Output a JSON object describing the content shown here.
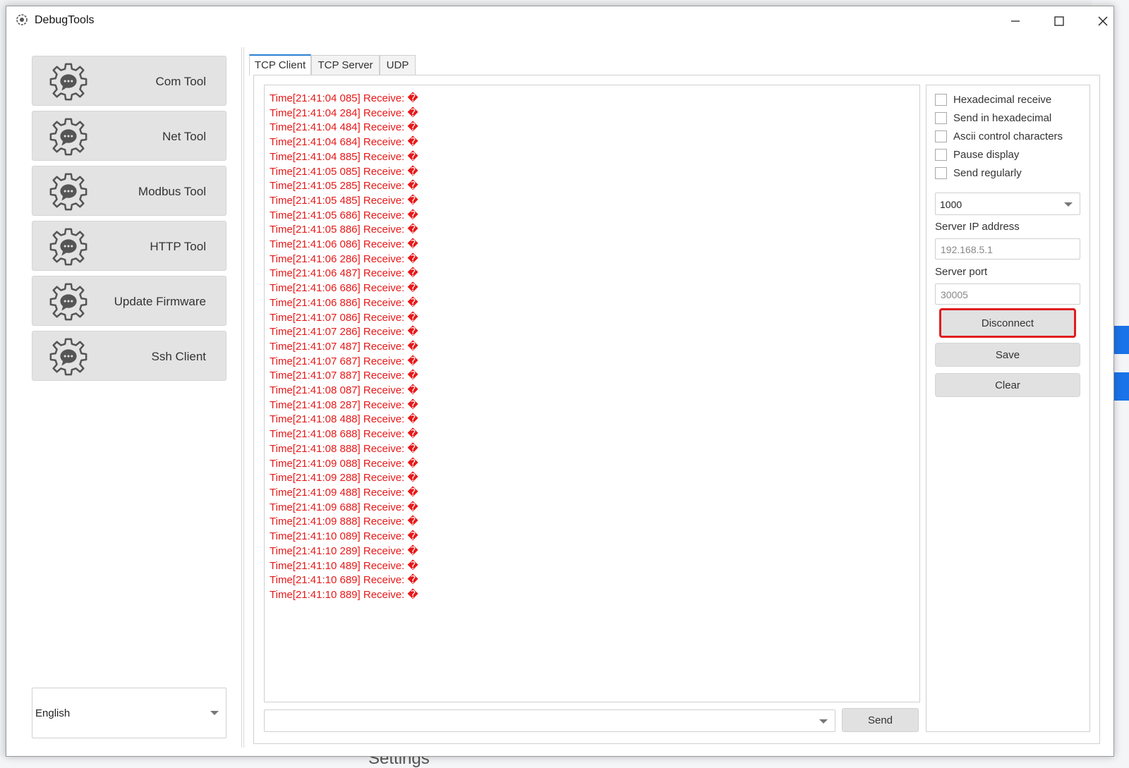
{
  "window": {
    "title": "DebugTools"
  },
  "sidebar": {
    "items": [
      {
        "label": "Com Tool"
      },
      {
        "label": "Net Tool"
      },
      {
        "label": "Modbus Tool"
      },
      {
        "label": "HTTP Tool"
      },
      {
        "label": "Update Firmware"
      },
      {
        "label": "Ssh Client"
      }
    ],
    "language": "English"
  },
  "tabs": [
    {
      "label": "TCP Client",
      "active": true
    },
    {
      "label": "TCP Server",
      "active": false
    },
    {
      "label": "UDP",
      "active": false
    }
  ],
  "log": {
    "lines": [
      "Time[21:41:04 085] Receive: �",
      "Time[21:41:04 284] Receive: �",
      "Time[21:41:04 484] Receive: �",
      "Time[21:41:04 684] Receive: �",
      "Time[21:41:04 885] Receive: �",
      "Time[21:41:05 085] Receive: �",
      "Time[21:41:05 285] Receive: �",
      "Time[21:41:05 485] Receive: �",
      "Time[21:41:05 686] Receive: �",
      "Time[21:41:05 886] Receive: �",
      "Time[21:41:06 086] Receive: �",
      "Time[21:41:06 286] Receive: �",
      "Time[21:41:06 487] Receive: �",
      "Time[21:41:06 686] Receive: �",
      "Time[21:41:06 886] Receive: �",
      "Time[21:41:07 086] Receive: �",
      "Time[21:41:07 286] Receive: �",
      "Time[21:41:07 487] Receive: �",
      "Time[21:41:07 687] Receive: �",
      "Time[21:41:07 887] Receive: �",
      "Time[21:41:08 087] Receive: �",
      "Time[21:41:08 287] Receive: �",
      "Time[21:41:08 488] Receive: �",
      "Time[21:41:08 688] Receive: �",
      "Time[21:41:08 888] Receive: �",
      "Time[21:41:09 088] Receive: �",
      "Time[21:41:09 288] Receive: �",
      "Time[21:41:09 488] Receive: �",
      "Time[21:41:09 688] Receive: �",
      "Time[21:41:09 888] Receive: �",
      "Time[21:41:10 089] Receive: �",
      "Time[21:41:10 289] Receive: �",
      "Time[21:41:10 489] Receive: �",
      "Time[21:41:10 689] Receive: �",
      "Time[21:41:10 889] Receive: �"
    ],
    "text_color": "#e81818"
  },
  "send": {
    "input_value": "",
    "button_label": "Send"
  },
  "options": {
    "checkboxes": [
      {
        "label": "Hexadecimal receive",
        "checked": false
      },
      {
        "label": "Send in hexadecimal",
        "checked": false
      },
      {
        "label": "Ascii control characters",
        "checked": false
      },
      {
        "label": "Pause display",
        "checked": false
      },
      {
        "label": "Send regularly",
        "checked": false
      }
    ],
    "interval": "1000",
    "server_ip_label": "Server IP address",
    "server_ip": "192.168.5.1",
    "server_port_label": "Server port",
    "server_port": "30005",
    "disconnect_label": "Disconnect",
    "save_label": "Save",
    "clear_label": "Clear"
  },
  "background": {
    "settings_text": "Settings"
  },
  "colors": {
    "accent": "#2a7fd4",
    "highlight": "#e11d1d"
  }
}
